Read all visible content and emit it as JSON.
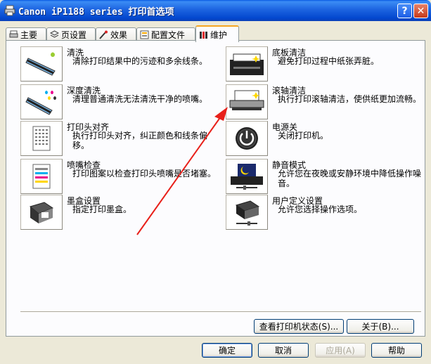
{
  "window": {
    "title": "Canon iP1188 series 打印首选项",
    "help_glyph": "?",
    "close_glyph": "✕"
  },
  "tabs": [
    {
      "label": "主要",
      "icon": "main-icon"
    },
    {
      "label": "页设置",
      "icon": "page-setup-icon"
    },
    {
      "label": "效果",
      "icon": "effects-icon"
    },
    {
      "label": "配置文件",
      "icon": "profile-icon"
    },
    {
      "label": "维护",
      "icon": "maintenance-icon",
      "active": true
    }
  ],
  "left_items": [
    {
      "name": "清洗",
      "desc": "清除打印结果中的污迹和多余线条。",
      "icon": "cleaning-icon"
    },
    {
      "name": "深度清洗",
      "desc": "清理普通清洗无法清洗干净的喷嘴。",
      "icon": "deep-cleaning-icon"
    },
    {
      "name": "打印头对齐",
      "desc": "执行打印头对齐，纠正颜色和线条偏移。",
      "icon": "print-head-alignment-icon"
    },
    {
      "name": "喷嘴检查",
      "desc": "打印图案以检查打印头喷嘴是否堵塞。",
      "icon": "nozzle-check-icon"
    },
    {
      "name": "墨盒设置",
      "desc": "指定打印墨盒。",
      "icon": "ink-cartridge-icon"
    }
  ],
  "right_items": [
    {
      "name": "底板清洁",
      "desc": "避免打印过程中纸张弄脏。",
      "icon": "bottom-plate-cleaning-icon"
    },
    {
      "name": "滚轴清洁",
      "desc": "执行打印滚轴清洁，使供纸更加流畅。",
      "icon": "roller-cleaning-icon"
    },
    {
      "name": "电源关",
      "desc": "关闭打印机。",
      "icon": "power-icon"
    },
    {
      "name": "静音模式",
      "desc": "允许您在夜晚或安静环境中降低操作噪音。",
      "icon": "quiet-mode-icon"
    },
    {
      "name": "用户定义设置",
      "desc": "允许您选择操作选项。",
      "icon": "custom-settings-icon"
    }
  ],
  "panel_buttons": {
    "status": "查看打印机状态(S)...",
    "about": "关于(B)..."
  },
  "dialog_buttons": {
    "ok": "确定",
    "cancel": "取消",
    "apply": "应用(A)",
    "help": "帮助"
  },
  "colors": {
    "titlebar": "#0348cf",
    "annotation_arrow": "#e8201a",
    "active_tab_highlight": "#f5a623"
  }
}
